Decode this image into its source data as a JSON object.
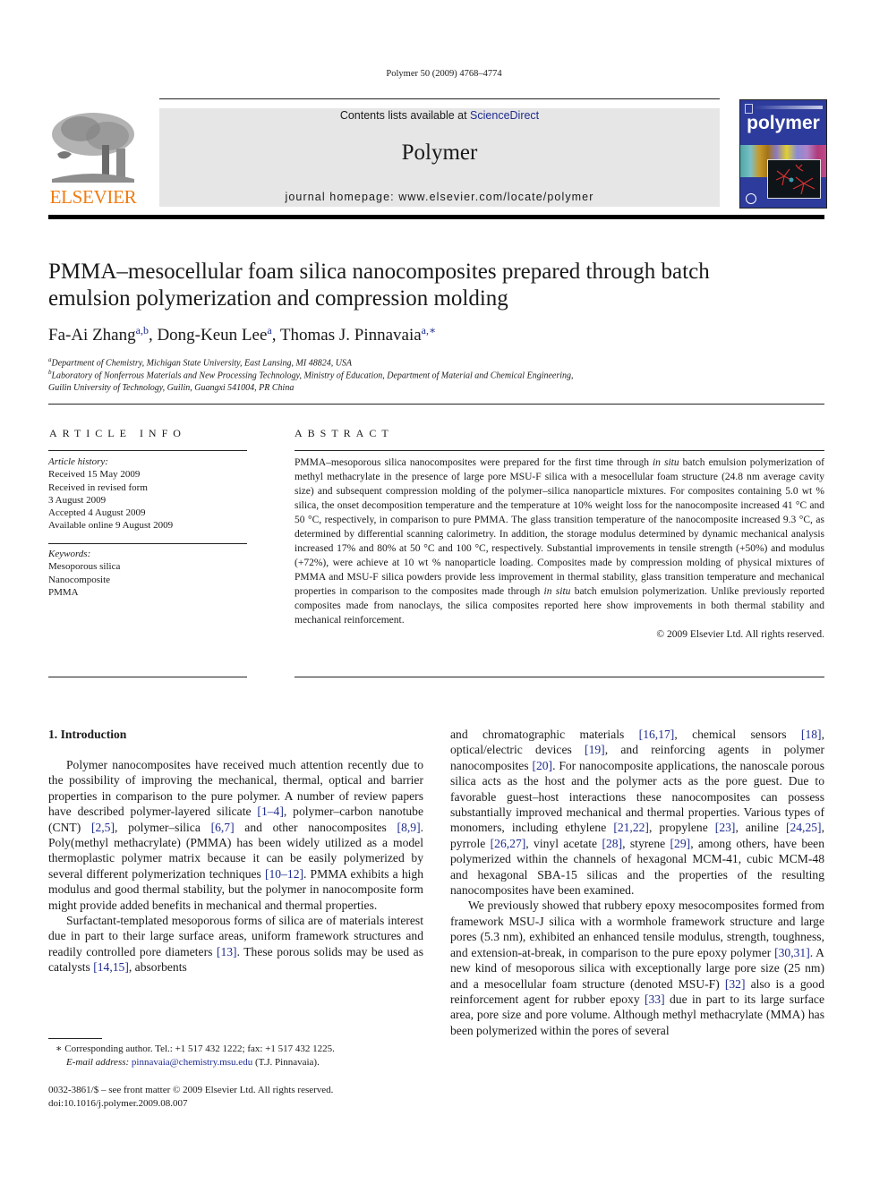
{
  "running_head": "Polymer 50 (2009) 4768–4774",
  "masthead": {
    "contents_prefix": "Contents lists available at ",
    "contents_link": "ScienceDirect",
    "journal_name": "Polymer",
    "homepage": "journal homepage: www.elsevier.com/locate/polymer",
    "publisher_logo_text": "ELSEVIER",
    "cover_title": "polymer"
  },
  "colors": {
    "link": "#1f2c8f",
    "elsevier_orange": "#f07c12",
    "cover_blue": "#2d3b9c",
    "masthead_gray": "#e6e6e6"
  },
  "article": {
    "title": "PMMA–mesocellular foam silica nanocomposites prepared through batch emulsion polymerization and compression molding",
    "authors": [
      {
        "name": "Fa-Ai Zhang",
        "sup": "a,b",
        "sep": ", "
      },
      {
        "name": "Dong-Keun Lee",
        "sup": "a",
        "sep": ", "
      },
      {
        "name": "Thomas J. Pinnavaia",
        "sup": "a,∗",
        "sep": ""
      }
    ],
    "affiliations": [
      {
        "mark": "a",
        "text": "Department of Chemistry, Michigan State University, East Lansing, MI 48824, USA"
      },
      {
        "mark": "b",
        "text": "Laboratory of Nonferrous Materials and New Processing Technology, Ministry of Education, Department of Material and Chemical Engineering,",
        "text2": "Guilin University of Technology, Guilin, Guangxi 541004, PR China"
      }
    ]
  },
  "article_info": {
    "heading": "ARTICLE INFO",
    "history_label": "Article history:",
    "history": [
      "Received 15 May 2009",
      "Received in revised form",
      "3 August 2009",
      "Accepted 4 August 2009",
      "Available online 9 August 2009"
    ],
    "keywords_label": "Keywords:",
    "keywords": [
      "Mesoporous silica",
      "Nanocomposite",
      "PMMA"
    ]
  },
  "abstract": {
    "heading": "ABSTRACT",
    "p1": "PMMA–mesoporous silica nanocomposites were prepared for the first time through ",
    "p1_em": "in situ",
    "p2": " batch emulsion polymerization of methyl methacrylate in the presence of large pore MSU-F silica with a mesocellular foam structure (24.8 nm average cavity size) and subsequent compression molding of the polymer–silica nanoparticle mixtures. For composites containing 5.0 wt % silica, the onset decomposition temperature and the temperature at 10% weight loss for the nanocomposite increased 41 °C and 50 °C, respectively, in comparison to pure PMMA. The glass transition temperature of the nanocomposite increased 9.3 °C, as determined by differential scanning calorimetry. In addition, the storage modulus determined by dynamic mechanical analysis increased 17% and 80% at 50 °C and 100 °C, respectively. Substantial improvements in tensile strength (+50%) and modulus (+72%), were achieve at 10 wt % nanoparticle loading. Composites made by compression molding of physical mixtures of PMMA and MSU-F silica powders provide less improvement in thermal stability, glass transition temperature and mechanical properties in comparison to the composites made through ",
    "p2_em": "in situ",
    "p3": " batch emulsion polymerization. Unlike previously reported composites made from nanoclays, the silica composites reported here show improvements in both thermal stability and mechanical reinforcement.",
    "copyright": "© 2009 Elsevier Ltd. All rights reserved."
  },
  "intro": {
    "heading": "1.  Introduction",
    "left_paragraphs": [
      [
        {
          "t": "Polymer nanocomposites have received much attention recently due to the possibility of improving the mechanical, thermal, optical and barrier properties in comparison to the pure polymer. A number of review papers have described polymer-layered silicate "
        },
        {
          "r": "[1–4]"
        },
        {
          "t": ", polymer–carbon nanotube (CNT) "
        },
        {
          "r": "[2,5]"
        },
        {
          "t": ", polymer–silica "
        },
        {
          "r": "[6,7]"
        },
        {
          "t": " and other nanocomposites "
        },
        {
          "r": "[8,9]"
        },
        {
          "t": ". Poly(methyl methacrylate) (PMMA) has been widely utilized as a model thermoplastic polymer matrix because it can be easily polymerized by several different polymerization techniques "
        },
        {
          "r": "[10–12]"
        },
        {
          "t": ". PMMA exhibits a high modulus and good thermal stability, but the polymer in nanocomposite form might provide added benefits in mechanical and thermal properties."
        }
      ],
      [
        {
          "t": "Surfactant-templated mesoporous forms of silica are of materials interest due in part to their large surface areas, uniform framework structures and readily controlled pore diameters "
        },
        {
          "r": "[13]"
        },
        {
          "t": ". These porous solids may be used as catalysts "
        },
        {
          "r": "[14,15]"
        },
        {
          "t": ", absorbents"
        }
      ]
    ],
    "right_paragraphs": [
      [
        {
          "t": "and chromatographic materials "
        },
        {
          "r": "[16,17]"
        },
        {
          "t": ", chemical sensors "
        },
        {
          "r": "[18]"
        },
        {
          "t": ", optical/electric devices "
        },
        {
          "r": "[19]"
        },
        {
          "t": ", and reinforcing agents in polymer nanocomposites "
        },
        {
          "r": "[20]"
        },
        {
          "t": ". For nanocomposite applications, the nanoscale porous silica acts as the host and the polymer acts as the pore guest. Due to favorable guest–host interactions these nanocomposites can possess substantially improved mechanical and thermal properties. Various types of monomers, including ethylene "
        },
        {
          "r": "[21,22]"
        },
        {
          "t": ", propylene "
        },
        {
          "r": "[23]"
        },
        {
          "t": ", aniline "
        },
        {
          "r": "[24,25]"
        },
        {
          "t": ", pyrrole "
        },
        {
          "r": "[26,27]"
        },
        {
          "t": ", vinyl acetate "
        },
        {
          "r": "[28]"
        },
        {
          "t": ", styrene "
        },
        {
          "r": "[29]"
        },
        {
          "t": ", among others, have been polymerized within the channels of hexagonal MCM-41, cubic MCM-48 and hexagonal SBA-15 silicas and the properties of the resulting nanocomposites have been examined."
        }
      ],
      [
        {
          "t": "We previously showed that rubbery epoxy mesocomposites formed from framework MSU-J silica with a wormhole framework structure and large pores (5.3 nm), exhibited an enhanced tensile modulus, strength, toughness, and extension-at-break, in comparison to the pure epoxy polymer "
        },
        {
          "r": "[30,31]"
        },
        {
          "t": ". A new kind of mesoporous silica with exceptionally large pore size (25 nm) and a mesocellular foam structure (denoted MSU-F) "
        },
        {
          "r": "[32]"
        },
        {
          "t": " also is a good reinforcement agent for rubber epoxy "
        },
        {
          "r": "[33]"
        },
        {
          "t": " due in part to its large surface area, pore size and pore volume. Although methyl methacrylate (MMA) has been polymerized within the pores of several"
        }
      ]
    ]
  },
  "footnotes": {
    "corresponding": "∗  Corresponding author. Tel.: +1 517 432 1222; fax: +1 517 432 1225.",
    "email_label": "E-mail address: ",
    "email": "pinnavaia@chemistry.msu.edu",
    "email_suffix": " (T.J. Pinnavaia).",
    "front_matter": "0032-3861/$ – see front matter © 2009 Elsevier Ltd. All rights reserved.",
    "doi": "doi:10.1016/j.polymer.2009.08.007"
  }
}
